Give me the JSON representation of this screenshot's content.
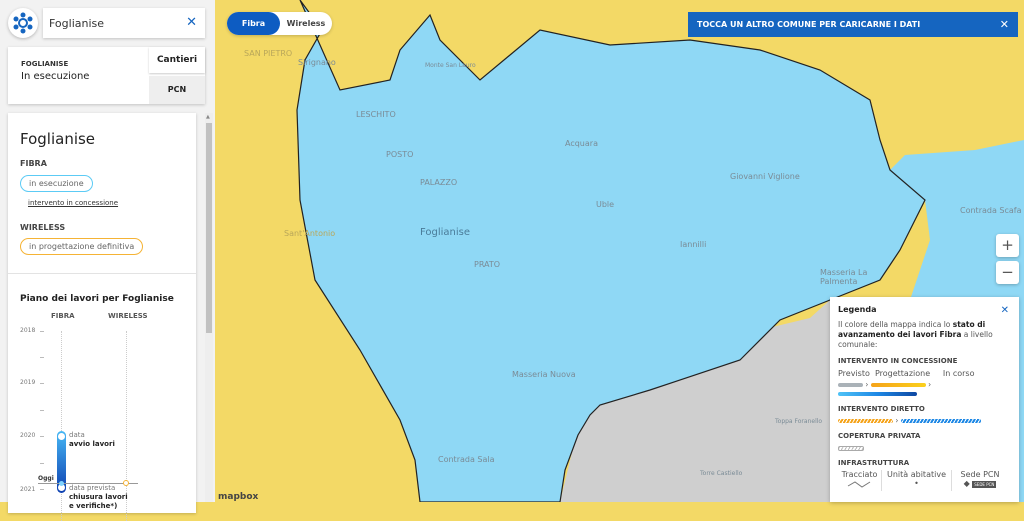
{
  "search": {
    "value": "Foglianise"
  },
  "status": {
    "label": "FOGLIANISE",
    "value": "In esecuzione",
    "cantieri": "Cantieri",
    "pcn": "PCN"
  },
  "card": {
    "title": "Foglianise",
    "fibra_label": "FIBRA",
    "fibra_status": "in esecuzione",
    "fibra_link": "intervento in concessione",
    "wireless_label": "WIRELESS",
    "wireless_status": "in progettazione definitiva",
    "plan_title": "Piano dei lavori per Foglianise",
    "col_fibra": "FIBRA",
    "col_wireless": "WIRELESS",
    "years": [
      "2018",
      "2019",
      "2020",
      "2021"
    ],
    "today": "Oggi",
    "start_small": "data",
    "start_bold": "avvio lavori",
    "end_small": "data prevista",
    "end_bold": "chiusura lavori",
    "end_bold2": "e verifiche*)"
  },
  "toggle": {
    "fibra": "Fibra",
    "wireless": "Wireless"
  },
  "notice": "TOCCA UN ALTRO COMUNE PER CARICARNE I DATI",
  "zoom": {
    "in": "+",
    "out": "−"
  },
  "legend": {
    "title": "Legenda",
    "desc_pre": "Il colore della mappa indica lo ",
    "desc_bold": "stato di avanzamento dei lavori Fibra",
    "desc_post": " a livello comunale:",
    "concessione": "INTERVENTO IN CONCESSIONE",
    "previsto": "Previsto",
    "progettazione": "Progettazione",
    "in_corso": "In corso",
    "diretto": "INTERVENTO DIRETTO",
    "privata": "COPERTURA PRIVATA",
    "infra": "INFRASTRUTTURA",
    "tracciato": "Tracciato",
    "unita": "Unità abitative",
    "sede": "Sede PCN",
    "sede_badge": "SEDE PCN"
  },
  "map_labels": [
    "Sirignano",
    "SAN PIETRO",
    "Monte San Lauro",
    "LESCHITO",
    "POSTO",
    "PALAZZO",
    "Acquara",
    "Giovanni Viglione",
    "Contrada Scafa",
    "Foglianise",
    "Uble",
    "Iannilli",
    "PRATO",
    "Masseria La Palmenta",
    "Masseria Nuova",
    "Contrada Sala",
    "Sant'Antonio",
    "Toppa Foranello",
    "Torre Castiello"
  ],
  "attribution": "mapbox",
  "colors": {
    "primary": "#1565c0",
    "fibra_map": "#8fd8f5",
    "yellow": "#f3d966"
  }
}
